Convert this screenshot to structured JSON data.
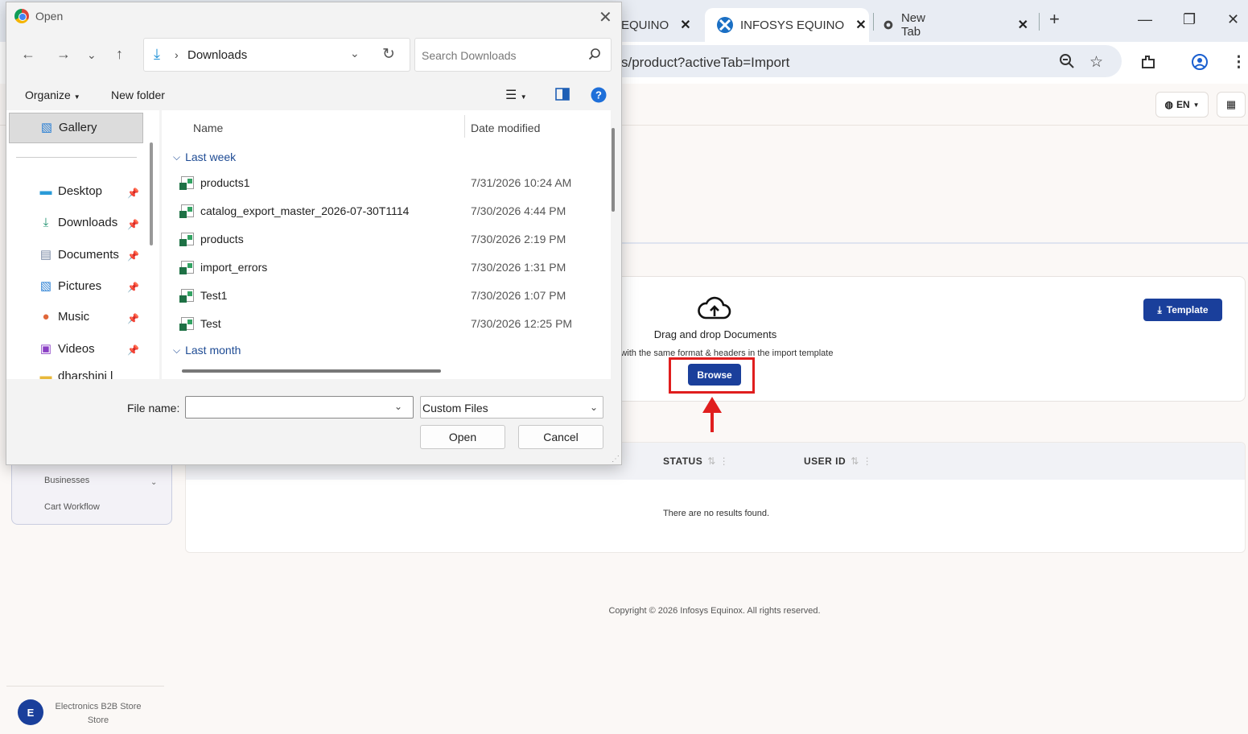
{
  "browser": {
    "tabs": [
      {
        "title": "EQUINO",
        "close": "✕"
      },
      {
        "title": "INFOSYS EQUINO",
        "close": "✕"
      },
      {
        "title": "New Tab",
        "close": "✕"
      }
    ],
    "new_tab": "+",
    "url": "s/product?activeTab=Import"
  },
  "page": {
    "language": "EN",
    "upload": {
      "title": "Drag and drop Documents",
      "hint": "e .xlsx file with the same format & headers in the import template",
      "browse_label": "Browse",
      "template_label": "Template"
    },
    "table": {
      "columns": [
        "STATUS",
        "USER ID"
      ],
      "empty_text": "There are no results found."
    },
    "sidebar": {
      "items": [
        {
          "label": "Businesses"
        },
        {
          "label": "Cart Workflow"
        }
      ]
    },
    "store": {
      "avatar_letter": "E",
      "name": "Electronics B2B Store",
      "type": "Store"
    },
    "footer": "Copyright © 2026 Infosys Equinox. All rights reserved."
  },
  "dialog": {
    "title": "Open",
    "path": "Downloads",
    "search_placeholder": "Search Downloads",
    "organize": "Organize",
    "new_folder": "New folder",
    "nav": {
      "gallery": "Gallery",
      "items": [
        {
          "label": "Desktop"
        },
        {
          "label": "Downloads"
        },
        {
          "label": "Documents"
        },
        {
          "label": "Pictures"
        },
        {
          "label": "Music"
        },
        {
          "label": "Videos"
        },
        {
          "label": "dharshini l"
        }
      ]
    },
    "columns": {
      "name": "Name",
      "date": "Date modified"
    },
    "groups": {
      "last_week": "Last week",
      "last_month": "Last month"
    },
    "files": [
      {
        "name": "products1",
        "date": "7/31/2026 10:24 AM"
      },
      {
        "name": "catalog_export_master_2026-07-30T1114",
        "date": "7/30/2026 4:44 PM"
      },
      {
        "name": "products",
        "date": "7/30/2026 2:19 PM"
      },
      {
        "name": "import_errors",
        "date": "7/30/2026 1:31 PM"
      },
      {
        "name": "Test1",
        "date": "7/30/2026 1:07 PM"
      },
      {
        "name": "Test",
        "date": "7/30/2026 12:25 PM"
      }
    ],
    "file_name_label": "File name:",
    "file_name_value": "",
    "file_type": "Custom Files",
    "open_label": "Open",
    "cancel_label": "Cancel"
  }
}
